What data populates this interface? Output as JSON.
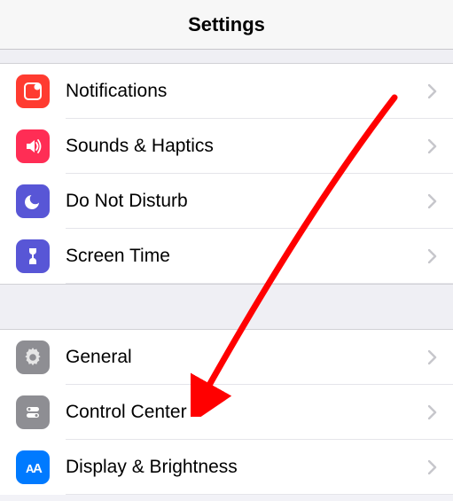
{
  "header": {
    "title": "Settings"
  },
  "section1": {
    "items": [
      {
        "label": "Notifications",
        "icon": "notifications-icon"
      },
      {
        "label": "Sounds & Haptics",
        "icon": "sounds-icon"
      },
      {
        "label": "Do Not Disturb",
        "icon": "dnd-icon"
      },
      {
        "label": "Screen Time",
        "icon": "screentime-icon"
      }
    ]
  },
  "section2": {
    "items": [
      {
        "label": "General",
        "icon": "general-icon"
      },
      {
        "label": "Control Center",
        "icon": "controlcenter-icon"
      },
      {
        "label": "Display & Brightness",
        "icon": "display-icon"
      }
    ]
  },
  "annotation": {
    "arrow_target": "Control Center",
    "arrow_color": "#ff0000"
  }
}
